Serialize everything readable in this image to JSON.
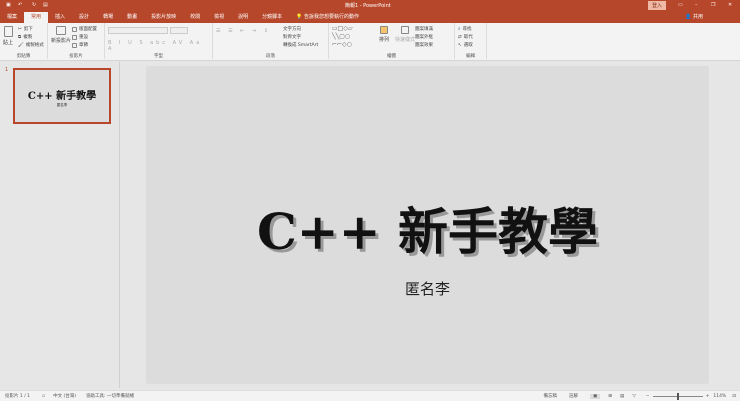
{
  "title": "簡報1 - PowerPoint",
  "window": {
    "sign_in": "登入"
  },
  "share": "共用",
  "tabs": [
    "檔案",
    "常用",
    "插入",
    "設計",
    "轉場",
    "動畫",
    "投影片放映",
    "校閱",
    "檢視",
    "說明",
    "分鏡腳本"
  ],
  "tell_me": "告訴我您想要執行的動作",
  "ribbon": {
    "clipboard": {
      "label": "剪貼簿",
      "paste": "貼上",
      "cut": "剪下",
      "copy": "複製",
      "format": "複製格式"
    },
    "slides": {
      "label": "投影片",
      "new": "新投影片",
      "layout": "版面配置",
      "reset": "重設",
      "section": "章節"
    },
    "font": {
      "label": "字型"
    },
    "paragraph": {
      "label": "段落",
      "text_dir": "文字方向",
      "align": "對齊文字",
      "smartart": "轉換成 SmartArt"
    },
    "drawing": {
      "label": "繪圖",
      "arrange": "排列",
      "quick_styles": "快速樣式",
      "fill": "圖案填滿",
      "outline": "圖案外框",
      "effects": "圖案效果"
    },
    "editing": {
      "label": "編輯",
      "find": "尋找",
      "replace": "取代",
      "select": "選取"
    }
  },
  "thumbnail": {
    "number": "1",
    "title": "C++ 新手教學",
    "subtitle": "匿名李"
  },
  "slide": {
    "title": "C++ 新手教學",
    "subtitle": "匿名李"
  },
  "status": {
    "slide": "投影片 1 / 1",
    "lang": "中文 (台灣)",
    "access": "協助工具: 一切準備就緒",
    "notes": "備忘稿",
    "comments": "註解",
    "zoom": "114%"
  }
}
